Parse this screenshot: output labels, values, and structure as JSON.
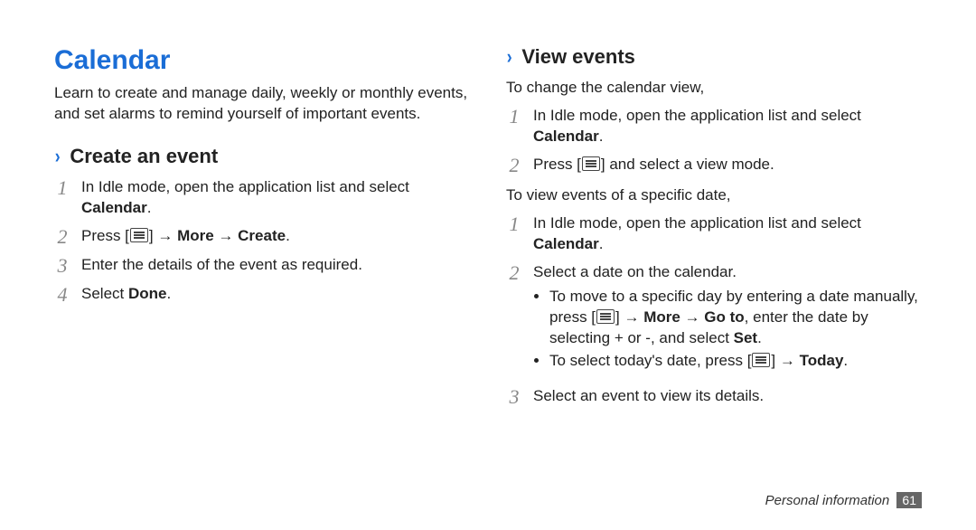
{
  "title": "Calendar",
  "lead": "Learn to create and manage daily, weekly or monthly events, and set alarms to remind yourself of important events.",
  "section_create": {
    "heading": "Create an event",
    "steps": {
      "s1_pre": "In Idle mode, open the application list and select ",
      "s1_bold": "Calendar",
      "s1_post": ".",
      "s2_pre": "Press [",
      "s2_mid1": "] → ",
      "s2_bold1": "More",
      "s2_mid2": " → ",
      "s2_bold2": "Create",
      "s2_post": ".",
      "s3": "Enter the details of the event as required.",
      "s4_pre": "Select ",
      "s4_bold": "Done",
      "s4_post": "."
    }
  },
  "section_view": {
    "heading": "View events",
    "intro1": "To change the calendar view,",
    "cv1_pre": "In Idle mode, open the application list and select ",
    "cv1_bold": "Calendar",
    "cv1_post": ".",
    "cv2_pre": "Press [",
    "cv2_post": "] and select a view mode.",
    "intro2": "To view events of a specific date,",
    "sd1_pre": "In Idle mode, open the application list and select ",
    "sd1_bold": "Calendar",
    "sd1_post": ".",
    "sd2": "Select a date on the calendar.",
    "b1_pre": "To move to a specific day by entering a date manually, press [",
    "b1_mid1": "] → ",
    "b1_bold1": "More",
    "b1_mid2": " → ",
    "b1_bold2": "Go to",
    "b1_mid3": ", enter the date by selecting + or -, and select ",
    "b1_bold3": "Set",
    "b1_post": ".",
    "b2_pre": "To select today's date, press [",
    "b2_mid": "] → ",
    "b2_bold": "Today",
    "b2_post": ".",
    "sd3": "Select an event to view its details."
  },
  "nums": {
    "n1": "1",
    "n2": "2",
    "n3": "3",
    "n4": "4"
  },
  "chevron": "›",
  "footer": {
    "section": "Personal information",
    "page": "61"
  }
}
